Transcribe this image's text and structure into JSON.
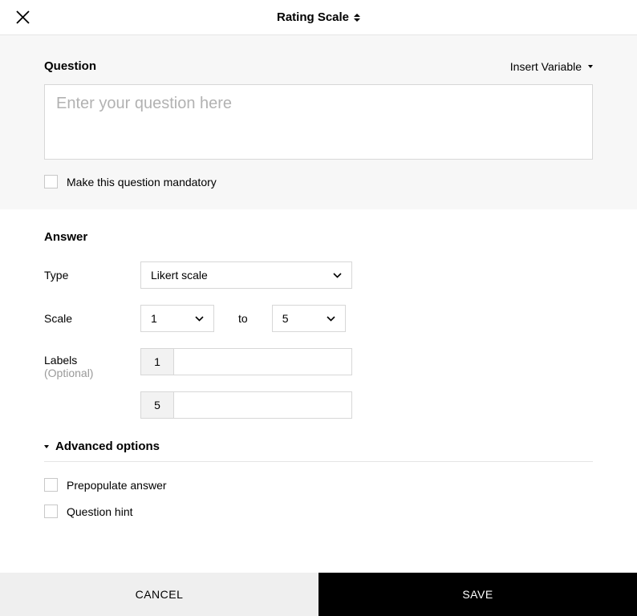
{
  "header": {
    "title": "Rating Scale"
  },
  "question": {
    "section_label": "Question",
    "insert_variable": "Insert Variable",
    "placeholder": "Enter your question here",
    "value": "",
    "mandatory_label": "Make this question mandatory"
  },
  "answer": {
    "section_label": "Answer",
    "type_label": "Type",
    "type_value": "Likert scale",
    "scale_label": "Scale",
    "scale_from": "1",
    "scale_to_word": "to",
    "scale_to": "5",
    "labels_label": "Labels",
    "labels_sub": "(Optional)",
    "label_rows": [
      {
        "prefix": "1",
        "value": ""
      },
      {
        "prefix": "5",
        "value": ""
      }
    ]
  },
  "advanced": {
    "header": "Advanced options",
    "prepopulate": "Prepopulate answer",
    "hint": "Question hint"
  },
  "footer": {
    "cancel": "CANCEL",
    "save": "SAVE"
  }
}
